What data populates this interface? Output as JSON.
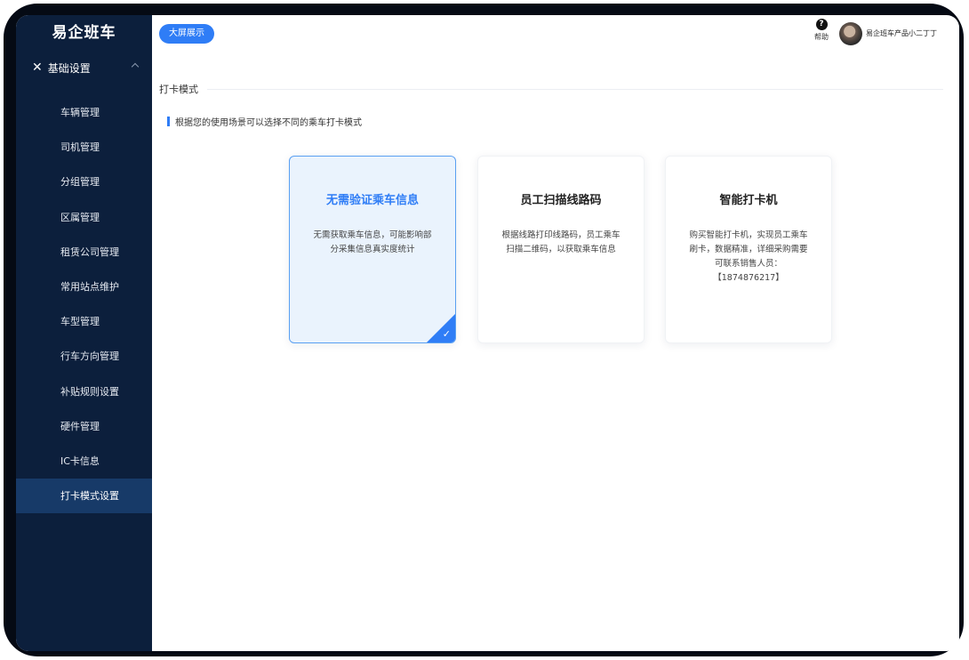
{
  "app": {
    "logo": "易企班车"
  },
  "sidebar": {
    "section_icon": "wrench-screwdriver-icon",
    "section_label": "基础设置",
    "items": [
      {
        "label": "车辆管理"
      },
      {
        "label": "司机管理"
      },
      {
        "label": "分组管理"
      },
      {
        "label": "区属管理"
      },
      {
        "label": "租赁公司管理"
      },
      {
        "label": "常用站点维护"
      },
      {
        "label": "车型管理"
      },
      {
        "label": "行车方向管理"
      },
      {
        "label": "补贴规则设置"
      },
      {
        "label": "硬件管理"
      },
      {
        "label": "IC卡信息"
      },
      {
        "label": "打卡模式设置",
        "active": true
      }
    ]
  },
  "topbar": {
    "screen_button": "大屏展示",
    "help_icon": "?",
    "help_label": "帮助",
    "user_name": "易企班车产品小二丁丁"
  },
  "main": {
    "page_title": "打卡模式",
    "hint": "根据您的使用场景可以选择不同的乘车打卡模式",
    "cards": [
      {
        "title": "无需验证乘车信息",
        "desc": "无需获取乘车信息，可能影响部分采集信息真实度统计",
        "selected": true
      },
      {
        "title": "员工扫描线路码",
        "desc": "根据线路打印线路码，员工乘车扫描二维码，以获取乘车信息",
        "selected": false
      },
      {
        "title": "智能打卡机",
        "desc": "购买智能打卡机，实现员工乘车刷卡，数据精准，详细采购需要可联系销售人员：【1874876217】",
        "selected": false
      }
    ]
  },
  "colors": {
    "sidebar_bg": "#0c1f3c",
    "sidebar_active": "#173a68",
    "accent": "#2f7df6"
  }
}
